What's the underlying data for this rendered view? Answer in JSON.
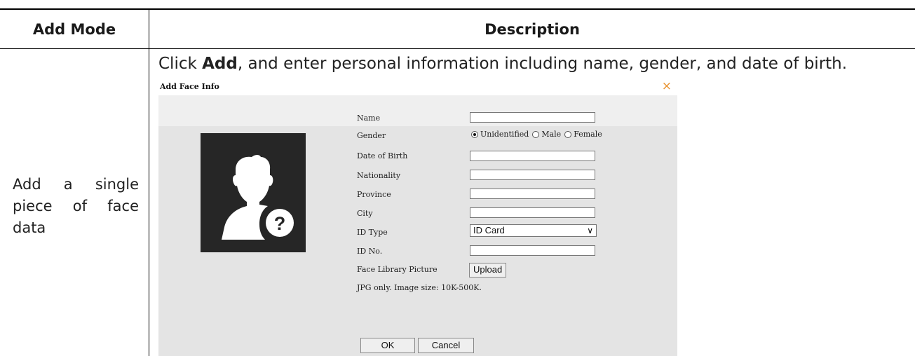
{
  "table": {
    "header_mode": "Add Mode",
    "header_description": "Description",
    "row_mode": "Add a single piece of face data",
    "intro_prefix": "Click ",
    "intro_bold": "Add",
    "intro_suffix": ", and enter personal information including name, gender, and date of birth."
  },
  "dialog": {
    "title": "Add Face Info",
    "close_glyph": "×",
    "fields": {
      "name": "Name",
      "gender": "Gender",
      "dob": "Date of Birth",
      "nationality": "Nationality",
      "province": "Province",
      "city": "City",
      "id_type": "ID Type",
      "id_no": "ID No.",
      "face_picture": "Face Library Picture"
    },
    "gender_options": [
      "Unidentified",
      "Male",
      "Female"
    ],
    "gender_selected": "Unidentified",
    "id_type_value": "ID Card",
    "upload_label": "Upload",
    "hint": "JPG only. Image size: 10K-500K.",
    "ok_label": "OK",
    "cancel_label": "Cancel"
  },
  "colors": {
    "close_accent": "#e8902b",
    "dialog_bg": "#e4e4e4",
    "photo_bg": "#262626"
  }
}
